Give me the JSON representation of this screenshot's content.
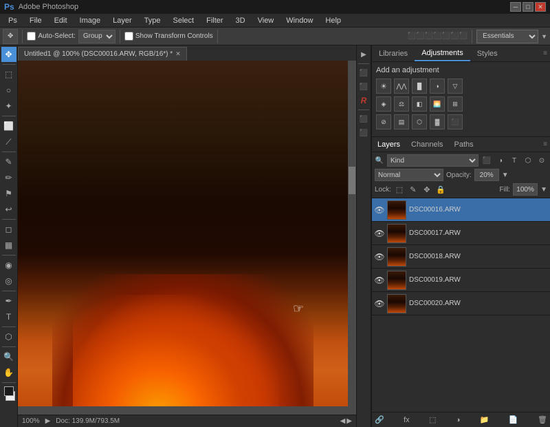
{
  "titlebar": {
    "icon": "PS",
    "title": "Adobe Photoshop",
    "controls": [
      "─",
      "□",
      "✕"
    ]
  },
  "menubar": {
    "items": [
      "PS",
      "File",
      "Edit",
      "Image",
      "Layer",
      "Type",
      "Select",
      "Filter",
      "3D",
      "View",
      "Window",
      "Help"
    ]
  },
  "toolbar": {
    "auto_select_label": "Auto-Select:",
    "group_option": "Group",
    "show_transform_label": "Show Transform Controls",
    "workspace_label": "Essentials"
  },
  "canvas": {
    "tab_title": "Untitled1 @ 100% (DSC00016.ARW, RGB/16*) *",
    "zoom": "100%",
    "doc_size": "Doc: 139.9M/793.5M"
  },
  "adjustments_panel": {
    "tabs": [
      "Libraries",
      "Adjustments",
      "Styles"
    ],
    "active_tab": "Adjustments",
    "add_adjustment": "Add an adjustment"
  },
  "layers_panel": {
    "tabs": [
      "Layers",
      "Channels",
      "Paths"
    ],
    "active_tab": "Layers",
    "kind_label": "Kind",
    "blend_mode": "Normal",
    "opacity_label": "Opacity:",
    "opacity_value": "20%",
    "lock_label": "Lock:",
    "fill_label": "Fill:",
    "fill_value": "100%",
    "layers": [
      {
        "name": "DSC00016.ARW",
        "visible": true,
        "active": true
      },
      {
        "name": "DSC00017.ARW",
        "visible": true,
        "active": false
      },
      {
        "name": "DSC00018.ARW",
        "visible": true,
        "active": false
      },
      {
        "name": "DSC00019.ARW",
        "visible": true,
        "active": false
      },
      {
        "name": "DSC00020.ARW",
        "visible": true,
        "active": false
      }
    ]
  },
  "left_tools": [
    "↖",
    "✥",
    "⬚",
    "○",
    "⟋",
    "✎",
    "✐",
    "⬛",
    "⟲",
    "🔍",
    "↗",
    "✋",
    "📷"
  ],
  "mid_tools": [
    "▶",
    "⬛",
    "⬛",
    "R",
    "⬛",
    "⬛"
  ]
}
